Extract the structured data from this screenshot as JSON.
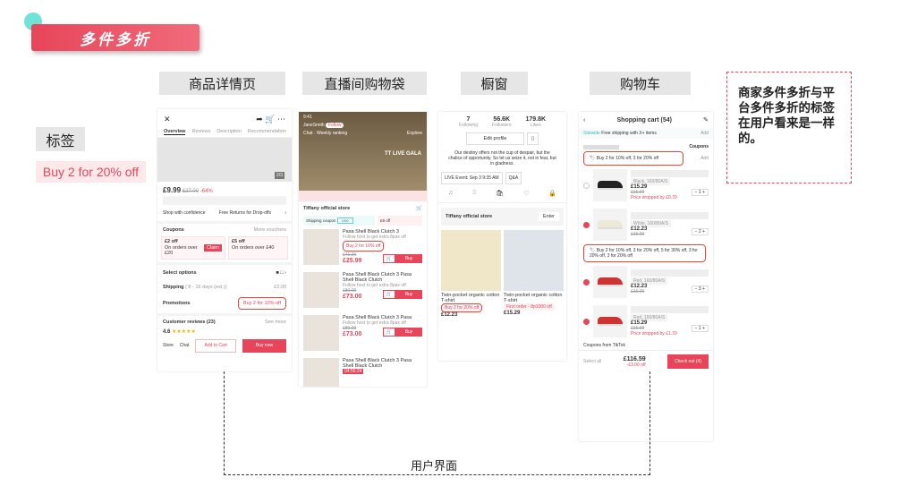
{
  "title": "多件多折",
  "sections": [
    "商品详情页",
    "直播间购物袋",
    "橱窗",
    "购物车"
  ],
  "tag_label": "标签",
  "tag_example": "Buy 2 for 20% off",
  "note": "商家多件多折与平台多件多折的标签在用户看来是一样的。",
  "bottom_label": "用户界面",
  "pdp": {
    "tabs": [
      "Overview",
      "Reviews",
      "Description",
      "Recommendation"
    ],
    "img_counter": "2/3",
    "price": "£9.99",
    "old_price": "£27.00",
    "discount": "-64%",
    "shop_conf": "Shop with confidence",
    "free_returns": "Free Returns for Drop-offs",
    "coupons": "Coupons",
    "more_vouchers": "More vouchers",
    "coupon1": "£2 off",
    "coupon1_cond": "On orders over £20",
    "claim": "Claim",
    "coupon2": "£5 off",
    "coupon2_cond": "On orders over £40",
    "select_options": "Select options",
    "shipping": "Shipping",
    "shipping_days": "( 8 - 16 days (est.))",
    "shipping_price": "£2.00",
    "promotions": "Promotions",
    "promo": "Buy 2 for 10% off",
    "reviews": "Customer reviews (23)",
    "see_more": "See more",
    "rating": "4.6",
    "store": "Store",
    "chat": "Chat",
    "add_to_cart": "Add to Cart",
    "buy_now": "Buy now"
  },
  "live": {
    "time": "9:41",
    "host": "JaneSmith",
    "follow": "Follow",
    "chat": "Chat",
    "weekly": "Weekly ranking",
    "explore": "Explore",
    "gala": "TT LIVE GALA",
    "store": "Tiffany official store",
    "ship_coupon": "Shipping coupon",
    "use": "Use",
    "coupon2": "£8 off",
    "items": [
      {
        "title": "Pasa Shell Black Clutch 3",
        "sub": "Follow host to get extra 8pax off",
        "promo": "Buy 2 for 10% off",
        "old": "£41.20",
        "price": "£25.99"
      },
      {
        "title": "Pasa Shell Black Clutch 3 Pasa Shell Black Clutch",
        "sub": "Follow host to get extra 8pax off",
        "old": "£80.00",
        "price": "£73.00"
      },
      {
        "title": "Pasa Shell Black Clutch 3 Pasa",
        "sub": "Follow host to get extra 8pax off",
        "old": "£80.00",
        "price": "£73.00"
      },
      {
        "title": "Pasa Shell Black Clutch 3 Pasa Shell Black Clutch",
        "timer": "04:56:24"
      }
    ],
    "buy": "Buy"
  },
  "showcase": {
    "stats": [
      {
        "n": "7",
        "l": "Following"
      },
      {
        "n": "56.6K",
        "l": "Followers"
      },
      {
        "n": "179.8K",
        "l": "Likes"
      }
    ],
    "edit": "Edit profile",
    "bio": "Our destiny offers not the cup of despair, but the chalice of opportunity. So let us seize it, not in fear, but in gladness.",
    "live_event": "LIVE Event: Sep 3 9:35 AM",
    "qa": "Q&A",
    "store": "Tiffany official store",
    "enter": "Enter",
    "items": [
      {
        "title": "Twin-pocket organic cotton T-shirt",
        "promo": "Buy 2 for 20% off",
        "price": "£12.23"
      },
      {
        "title": "Twin-pocket organic cotton T-shirt",
        "promo": "First order · 8p1000 off",
        "price": "£15.29"
      }
    ]
  },
  "cart": {
    "title": "Shopping cart (54)",
    "sitewide": "Sitewide",
    "free_ship": "Free shipping with X+ items",
    "add": "Add",
    "coupons": "Coupons",
    "promo1": "Buy 2 for 10% off, 3 for 20% off",
    "promo2": "Buy 2 for 10% off, 3 for 20% off, 5 for 30% off, 3 for 20% off, 3 for 20% off",
    "items": [
      {
        "variant": "Black, 160/80A/S",
        "price": "£15.29",
        "old": "£16.00",
        "drop": "Price dropped by £0.70",
        "qty": "1"
      },
      {
        "variant": "White, 160/80A/S",
        "price": "£12.23",
        "old": "£16.00",
        "qty": "2"
      },
      {
        "variant": "Red, 160/80A/S",
        "price": "£12.23",
        "old": "£16.00",
        "qty": "3"
      },
      {
        "variant": "Red, 160/80A/S",
        "price": "£15.29",
        "old": "£16.00",
        "drop": "Price dropped by £1.70",
        "qty": "1"
      }
    ],
    "tiktok_coupons": "Coupons from TikTok",
    "select_all": "Select all",
    "total": "£116.59",
    "saved": "-£3.00 off",
    "checkout": "Check out (4)"
  },
  "colors": {
    "accent": "#e8455a",
    "teal": "#6fe3d6"
  }
}
